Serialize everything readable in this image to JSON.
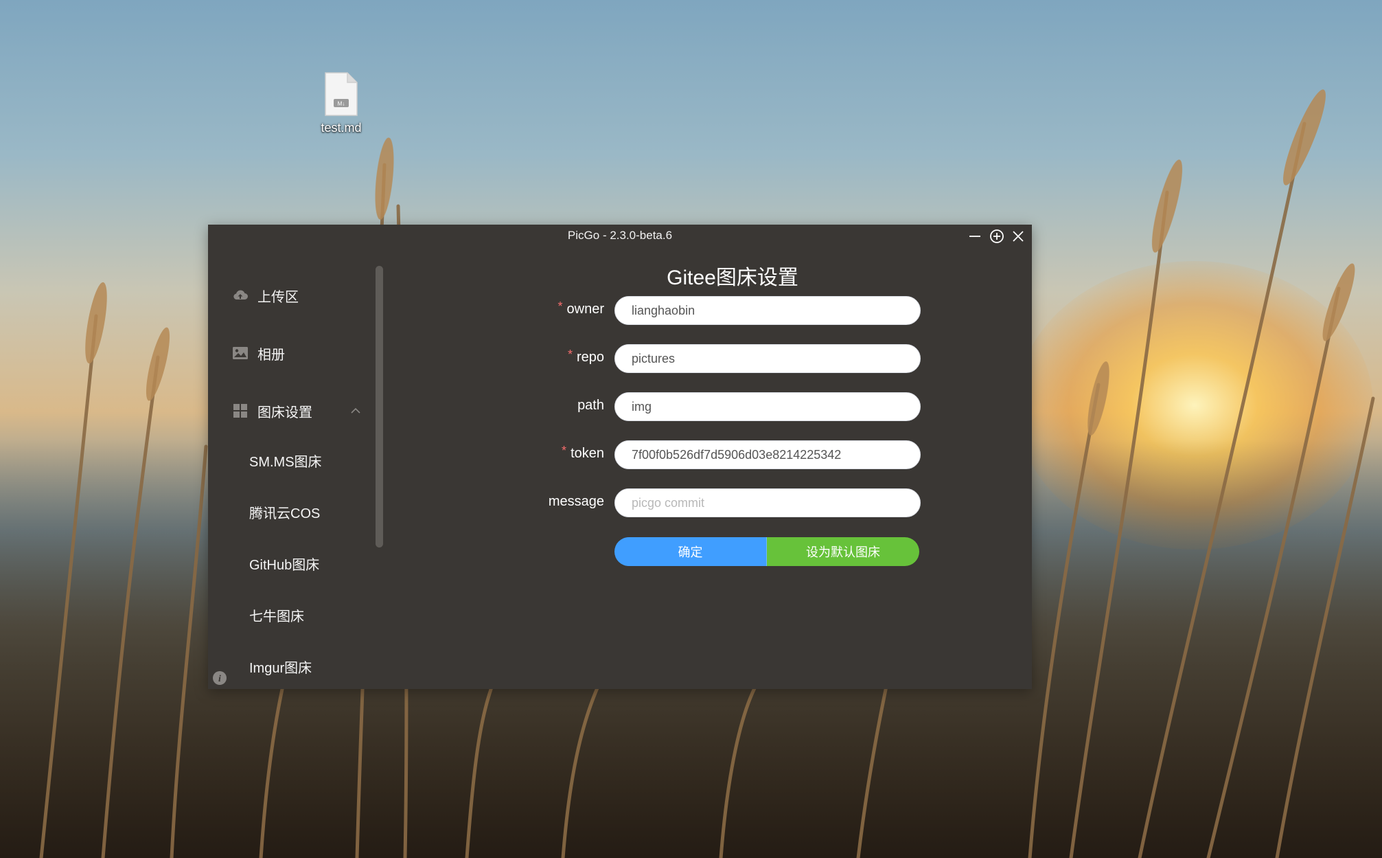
{
  "desktop": {
    "file": {
      "name": "test.md",
      "icon": "markdown-file-icon"
    }
  },
  "window": {
    "title": "PicGo - 2.3.0-beta.6",
    "controls": [
      "minimize-icon",
      "maximize-icon",
      "close-icon"
    ]
  },
  "sidebar": {
    "items": [
      {
        "label": "上传区",
        "icon": "cloud-upload-icon"
      },
      {
        "label": "相册",
        "icon": "picture-icon"
      },
      {
        "label": "图床设置",
        "icon": "grid-icon",
        "expanded": true
      }
    ],
    "subitems": [
      {
        "label": "SM.MS图床"
      },
      {
        "label": "腾讯云COS"
      },
      {
        "label": "GitHub图床"
      },
      {
        "label": "七牛图床"
      },
      {
        "label": "Imgur图床"
      }
    ],
    "info_icon": "info-icon"
  },
  "main": {
    "title": "Gitee图床设置",
    "fields": [
      {
        "label": "owner",
        "required": true,
        "value": "lianghaobin",
        "placeholder": ""
      },
      {
        "label": "repo",
        "required": true,
        "value": "pictures",
        "placeholder": ""
      },
      {
        "label": "path",
        "required": false,
        "value": "img",
        "placeholder": ""
      },
      {
        "label": "token",
        "required": true,
        "value": "7f00f0b526df7d5906d03e8214225342",
        "placeholder": ""
      },
      {
        "label": "message",
        "required": false,
        "value": "",
        "placeholder": "picgo commit"
      }
    ],
    "buttons": {
      "confirm": "确定",
      "set_default": "设为默认图床"
    }
  },
  "colors": {
    "window_bg": "#3a3734",
    "primary": "#409eff",
    "success": "#67c23a",
    "required_mark": "#f56c6c"
  }
}
